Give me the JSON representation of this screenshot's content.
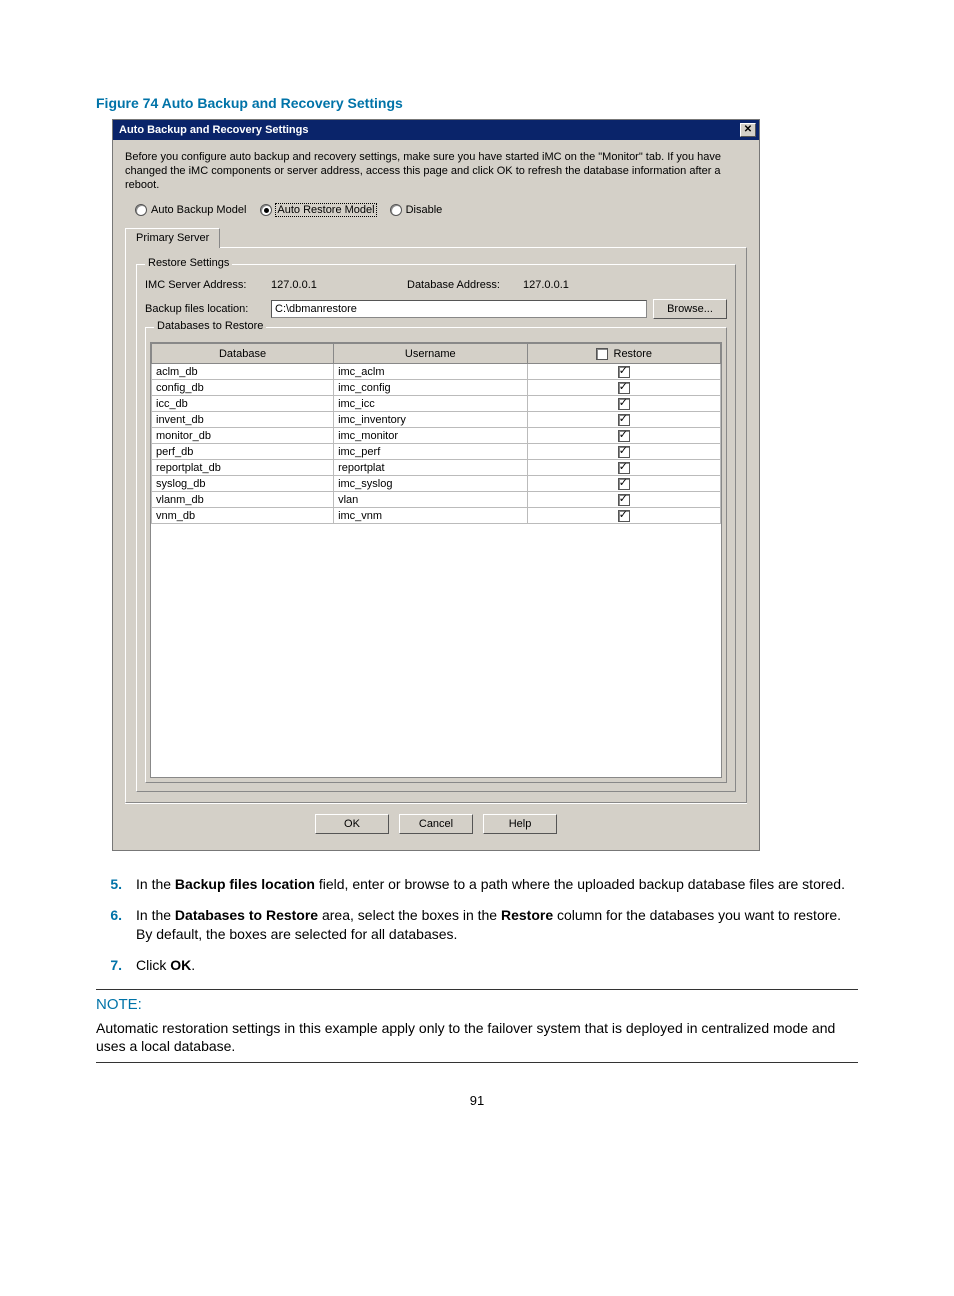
{
  "figure_caption": "Figure 74 Auto Backup and Recovery Settings",
  "dialog": {
    "title": "Auto Backup and Recovery Settings",
    "close_glyph": "✕",
    "intro": "Before you configure auto backup and recovery settings, make sure you have started iMC on the \"Monitor\" tab. If you have changed the iMC components or server address, access this page and click OK to refresh the database information after a reboot.",
    "radios": {
      "backup": "Auto Backup Model",
      "restore": "Auto Restore Model",
      "disable": "Disable"
    },
    "tab_primary": "Primary Server",
    "group_restore": "Restore Settings",
    "labels": {
      "imc_addr": "IMC Server Address:",
      "db_addr": "Database Address:",
      "backup_loc": "Backup files location:"
    },
    "values": {
      "imc_addr": "127.0.0.1",
      "db_addr": "127.0.0.1",
      "backup_loc": "C:\\dbmanrestore"
    },
    "buttons": {
      "browse": "Browse...",
      "ok": "OK",
      "cancel": "Cancel",
      "help": "Help"
    },
    "group_dbs": "Databases to Restore",
    "table": {
      "col_db": "Database",
      "col_user": "Username",
      "col_restore": "Restore",
      "rows": [
        {
          "db": "aclm_db",
          "user": "imc_aclm",
          "restore": true
        },
        {
          "db": "config_db",
          "user": "imc_config",
          "restore": true
        },
        {
          "db": "icc_db",
          "user": "imc_icc",
          "restore": true
        },
        {
          "db": "invent_db",
          "user": "imc_inventory",
          "restore": true
        },
        {
          "db": "monitor_db",
          "user": "imc_monitor",
          "restore": true
        },
        {
          "db": "perf_db",
          "user": "imc_perf",
          "restore": true
        },
        {
          "db": "reportplat_db",
          "user": "reportplat",
          "restore": true
        },
        {
          "db": "syslog_db",
          "user": "imc_syslog",
          "restore": true
        },
        {
          "db": "vlanm_db",
          "user": "vlan",
          "restore": true
        },
        {
          "db": "vnm_db",
          "user": "imc_vnm",
          "restore": true
        }
      ]
    }
  },
  "steps": {
    "s5_num": "5.",
    "s5_a": "In the ",
    "s5_b": "Backup files location",
    "s5_c": " field, enter or browse to a path where the uploaded backup database files are stored.",
    "s6_num": "6.",
    "s6_a": "In the ",
    "s6_b": "Databases to Restore",
    "s6_c": " area, select the boxes in the ",
    "s6_d": "Restore",
    "s6_e": " column for the databases you want to restore. By default, the boxes are selected for all databases.",
    "s7_num": "7.",
    "s7_a": "Click ",
    "s7_b": "OK",
    "s7_c": "."
  },
  "note": {
    "heading": "NOTE:",
    "body": "Automatic restoration settings in this example apply only to the failover system that is deployed in centralized mode and uses a local database."
  },
  "page_number": "91"
}
